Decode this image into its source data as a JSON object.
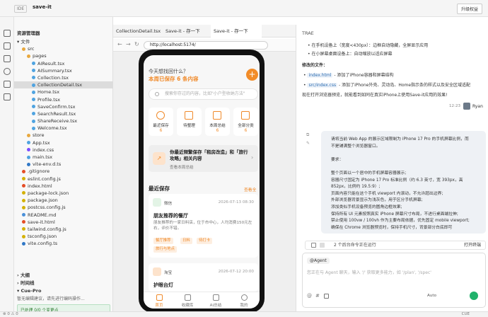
{
  "titlebar": {
    "ide": "IDE",
    "project": "save-it",
    "upgrade": "升级权益"
  },
  "explorer": {
    "title": "资源管理器",
    "section_files": "文件",
    "tree": [
      {
        "label": "src",
        "indent": 1,
        "kind": "folder-open"
      },
      {
        "label": "pages",
        "indent": 2,
        "kind": "folder-open"
      },
      {
        "label": "AIResult.tsx",
        "indent": 3,
        "kind": "tsx"
      },
      {
        "label": "AISummary.tsx",
        "indent": 3,
        "kind": "tsx"
      },
      {
        "label": "Collection.tsx",
        "indent": 3,
        "kind": "tsx"
      },
      {
        "label": "CollectionDetail.tsx",
        "indent": 3,
        "kind": "tsx",
        "selected": true
      },
      {
        "label": "Home.tsx",
        "indent": 3,
        "kind": "tsx"
      },
      {
        "label": "Profile.tsx",
        "indent": 3,
        "kind": "tsx"
      },
      {
        "label": "SaveConfirm.tsx",
        "indent": 3,
        "kind": "tsx"
      },
      {
        "label": "SearchResult.tsx",
        "indent": 3,
        "kind": "tsx"
      },
      {
        "label": "ShareReceive.tsx",
        "indent": 3,
        "kind": "tsx"
      },
      {
        "label": "Welcome.tsx",
        "indent": 3,
        "kind": "tsx"
      },
      {
        "label": "store",
        "indent": 2,
        "kind": "folder"
      },
      {
        "label": "App.tsx",
        "indent": 2,
        "kind": "tsx"
      },
      {
        "label": "index.css",
        "indent": 2,
        "kind": "css"
      },
      {
        "label": "main.tsx",
        "indent": 2,
        "kind": "tsx"
      },
      {
        "label": "vite-env.d.ts",
        "indent": 2,
        "kind": "ts"
      },
      {
        "label": ".gitignore",
        "indent": 1,
        "kind": "git"
      },
      {
        "label": "eslint.config.js",
        "indent": 1,
        "kind": "js"
      },
      {
        "label": "index.html",
        "indent": 1,
        "kind": "html"
      },
      {
        "label": "package-lock.json",
        "indent": 1,
        "kind": "json"
      },
      {
        "label": "package.json",
        "indent": 1,
        "kind": "json"
      },
      {
        "label": "postcss.config.js",
        "indent": 1,
        "kind": "js"
      },
      {
        "label": "README.md",
        "indent": 1,
        "kind": "md"
      },
      {
        "label": "save-it.html",
        "indent": 1,
        "kind": "html"
      },
      {
        "label": "tailwind.config.js",
        "indent": 1,
        "kind": "js"
      },
      {
        "label": "tsconfig.json",
        "indent": 1,
        "kind": "json"
      },
      {
        "label": "vite.config.ts",
        "indent": 1,
        "kind": "ts"
      }
    ],
    "outline": "大纲",
    "timeline": "时间线",
    "cue_title": "Cue-Pro",
    "cue_text": "暂无编辑建议，请先进行编码操作...",
    "cue_status": "已处理 0/0 个变更点"
  },
  "tabs": [
    "CollectionDetail.tsx",
    "Save-it - 存一下",
    "Save-it - 存一下"
  ],
  "browser": {
    "url": "http://localhost:5174/"
  },
  "app": {
    "greeting": "今天想找回什么？",
    "weekly_saved": "本周已保存 6 条内容",
    "search_placeholder": "搜索你存过的内容，比如\"小户型收纳方法\"",
    "cards": [
      {
        "label": "最近保存",
        "count": "6"
      },
      {
        "label": "待整理",
        "count": ""
      },
      {
        "label": "本周总结",
        "count": "6"
      },
      {
        "label": "全部分类",
        "count": "6"
      }
    ],
    "weekly_title": "你最近频繁保存「租房改造」和「旅行攻略」相关内容",
    "weekly_sub": "查看本周总结",
    "recent_title": "最近保存",
    "see_all": "查看全部",
    "posts": [
      {
        "source": "微信",
        "date": "2026-07-13 08:30",
        "title": "朋友推荐的餐厅",
        "desc": "朋友推荐的一家日料店，位于市中心，人均消费150元左右，评价不错。",
        "tags": [
          "餐厅推荐",
          "日料",
          "待打卡",
          "旅行与地点"
        ]
      },
      {
        "source": "淘宝",
        "date": "2026-07-12 20:00",
        "title": "护眼台灯",
        "desc": "",
        "tags": []
      }
    ],
    "nav": [
      {
        "label": "首页",
        "active": true
      },
      {
        "label": "收藏库",
        "active": false
      },
      {
        "label": "AI总结",
        "active": false
      },
      {
        "label": "我的",
        "active": false
      }
    ]
  },
  "chat": {
    "brand": "TRAE",
    "bullets_top": [
      "在手机设备上（宽度<430px）：边框自动隐藏，全屏显示应用",
      "在小屏幕桌面设备上：自动缩放以适应屏幕"
    ],
    "modified_heading": "修改的文件：",
    "modified_files": [
      {
        "file": "index.html",
        "note": " - 添加了iPhone容器和屏幕结构"
      },
      {
        "file": "src/index.css",
        "note": " - 添加了iPhone外壳、灵动岛、Home指示条的样式以及安全区域适配"
      }
    ],
    "summary": "现在打开浏览器预览，就能看到如同在真实iPhone上使用Save-it应用的效果!",
    "time": "12:23",
    "user": "Ryan",
    "message_lines": [
      "请将当前 Web App 的展示区域限制为 iPhone 17 Pro 的手机屏幕比例，而",
      "不是铺满整个浏览器窗口。",
      "",
      "要求：",
      "",
      "整个页面以一个居中的手机屏幕容器展示;",
      "容器尺寸固定为 iPhone 17 Pro 标准比例（约 6.3 英寸，宽 393px，高",
      "852px，比例约 19.5:9）;",
      "页面内容只能在这个手机 viewport 内滚动，不允许超出边界;",
      "外部浏览器背景显示为浅灰色，用于区分手机屏幕;",
      "添加类似手机设备预览的圆角边框效果;",
      "保持所有 UI 元素按照真实 iPhone 屏幕尺寸布局，不进行桌面端拉伸;",
      "禁止使用 100vw / 100vh 作为主要布局依据，优先固定 mobile viewport;",
      "确保在 Chrome 浏览器预览时，保持手机尺寸，背景部分白底即可"
    ],
    "pending": "2 个后台命令正在运行",
    "open_btn": "打开终端",
    "agent_tag": "@Agent",
    "placeholder": "您正在与 Agent 聊天，输入 '/' 获取更多能力，如 '/plan', '/spec'",
    "auto": "Auto"
  },
  "status_bar": {
    "left": "⊗ 0 ⚠ 0",
    "right": "CUE"
  },
  "colors": {
    "accent": "#f08a2a",
    "send": "#20b26b",
    "link": "#2b6cb0"
  }
}
